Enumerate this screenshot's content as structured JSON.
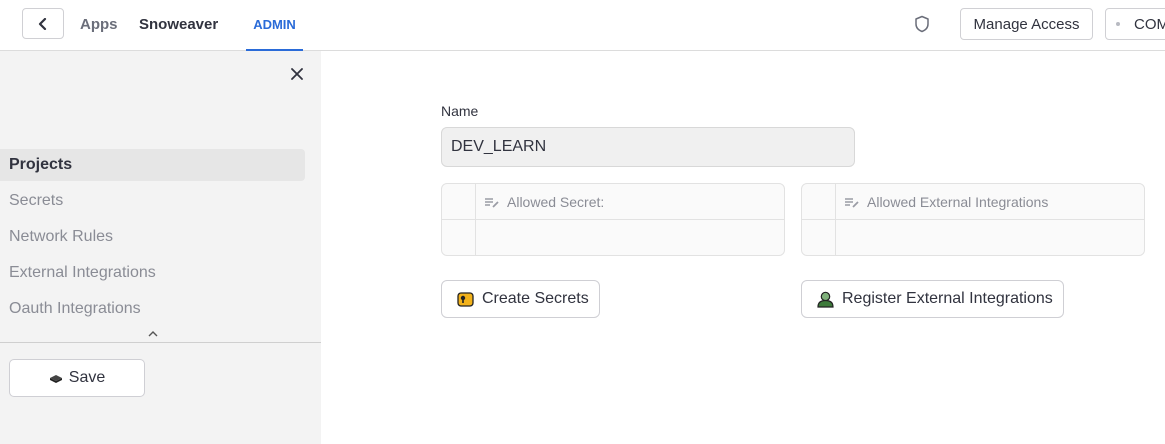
{
  "header": {
    "breadcrumb_apps": "Apps",
    "breadcrumb_app": "Snoweaver",
    "active_tab": "ADMIN",
    "manage_access_label": "Manage Access",
    "account_label": "COM"
  },
  "sidebar": {
    "items": [
      {
        "label": "Projects",
        "active": true
      },
      {
        "label": "Secrets",
        "active": false
      },
      {
        "label": "Network Rules",
        "active": false
      },
      {
        "label": "External Integrations",
        "active": false
      },
      {
        "label": "Oauth Integrations",
        "active": false
      }
    ],
    "save_label": "Save"
  },
  "main": {
    "name_label": "Name",
    "name_value": "DEV_LEARN",
    "secrets_table": {
      "column": "Allowed Secret:"
    },
    "integrations_table": {
      "column": "Allowed External Integrations"
    },
    "create_secrets_label": "Create Secrets",
    "register_integrations_label": "Register External Integrations"
  },
  "colors": {
    "accent": "#2a6bd8",
    "sidebar_bg": "#f3f3f3"
  }
}
